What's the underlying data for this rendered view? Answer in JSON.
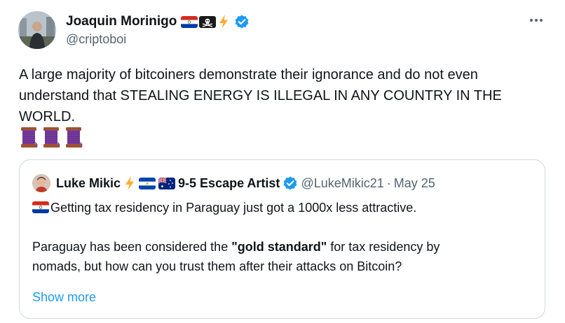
{
  "author": {
    "display_name": "Joaquin Morinigo",
    "handle": "@criptoboi",
    "name_emojis": [
      "paraguay-flag-icon",
      "pirate-flag-icon",
      "high-voltage-icon"
    ],
    "verified": true
  },
  "tweet": {
    "text": "A large majority of bitcoiners demonstrate their ignorance and do not even understand that STEALING ENERGY IS ILLEGAL IN ANY COUNTRY IN THE WORLD.",
    "trailing_emojis": [
      "thread-spool-icon",
      "thread-spool-icon",
      "thread-spool-icon"
    ]
  },
  "quoted_tweet": {
    "display_name": "Luke Mikic",
    "name_suffix": "9-5 Escape Artist",
    "name_emojis": [
      "high-voltage-icon",
      "el-salvador-flag-icon",
      "australia-flag-icon"
    ],
    "handle": "@LukeMikic21",
    "separator": "·",
    "date": "May 25",
    "line1": "Getting tax residency in Paraguay just got a 1000x less attractive.",
    "line2_before": "Paraguay has been considered the ",
    "line2_bold": "\"gold standard\"",
    "line2_after": " for tax residency by",
    "line3": "nomads, but how can you trust them after their attacks on Bitcoin?",
    "show_more": "Show more"
  },
  "colors": {
    "text": "#0f1419",
    "secondary": "#536471",
    "link": "#1d9bf0",
    "verified": "#1d9bf0",
    "border": "#cfd9de"
  }
}
